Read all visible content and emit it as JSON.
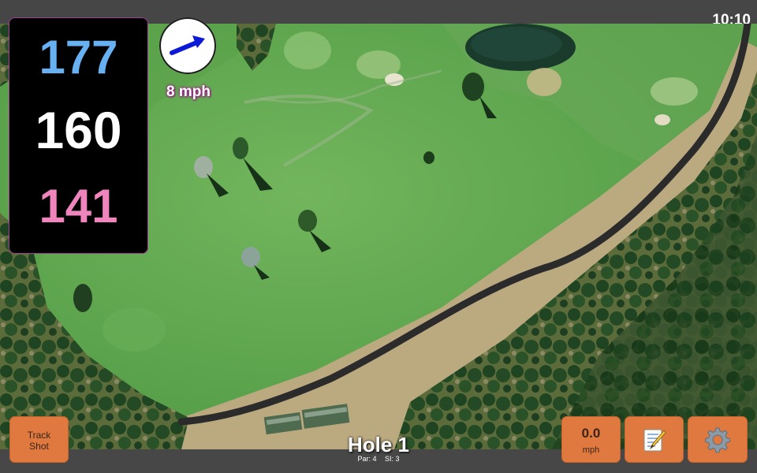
{
  "status": {
    "time": "10:10"
  },
  "distances": {
    "back": "177",
    "center": "160",
    "front": "141"
  },
  "wind": {
    "speed_text": "8 mph",
    "direction_icon": "arrow-northeast-icon"
  },
  "buttons": {
    "track_shot": {
      "line1": "Track",
      "line2": "Shot"
    },
    "wind_gauge": {
      "value": "0.0",
      "unit": "mph"
    },
    "notes_icon": "notepad-icon",
    "settings_icon": "gear-icon"
  },
  "hole": {
    "title": "Hole 1",
    "par": "Par: 4",
    "si": "SI: 3"
  },
  "colors": {
    "back_distance": "#67b1f2",
    "center_distance": "#ffffff",
    "front_distance": "#ef85bd",
    "button": "#e0793f",
    "panel_border": "#a3409a"
  }
}
